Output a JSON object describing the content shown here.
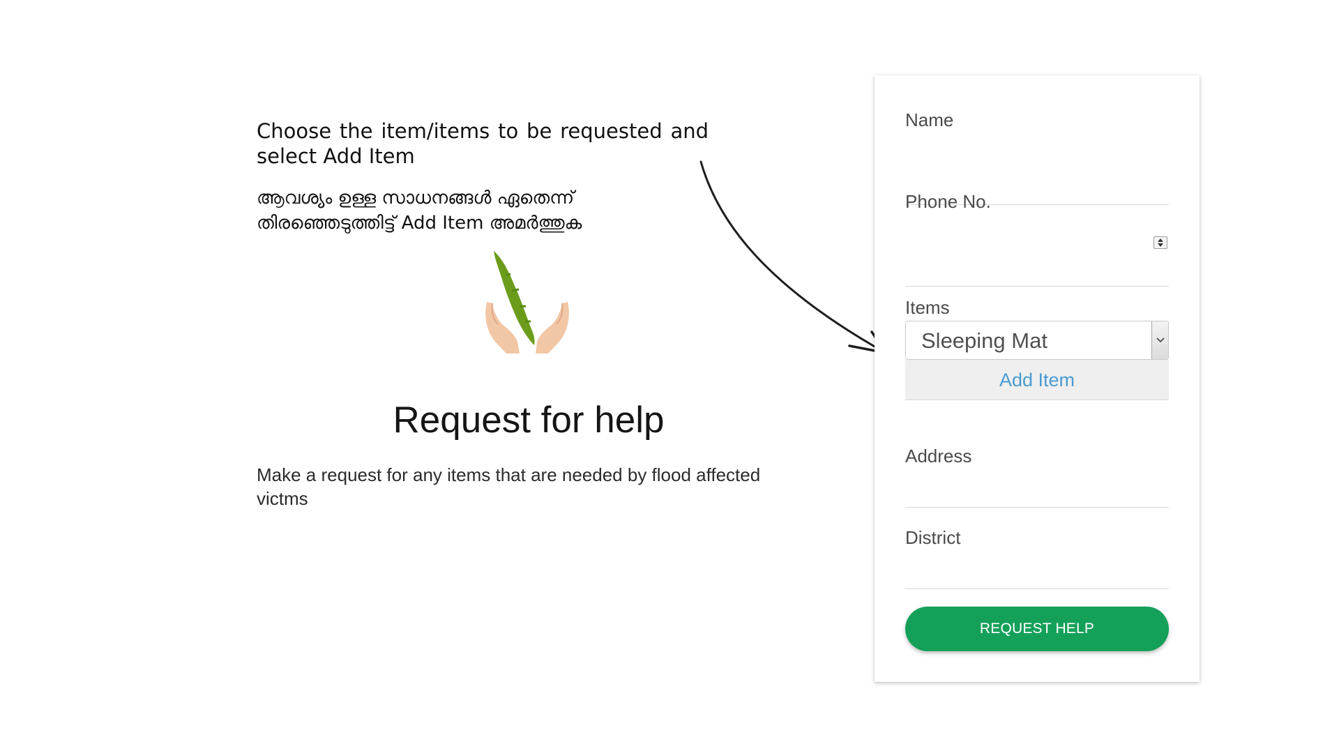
{
  "instructions": {
    "english": "Choose the item/items to be requested and select Add Item",
    "malayalam": "ആവശ്യം ഉള്ള സാധനങ്ങൾ ഏതെന്ന് തിരഞ്ഞെടുത്തിട്ട് Add Item അമർത്തുക"
  },
  "hero": {
    "title": "Request for help",
    "subtitle": "Make a request for any items that are needed by flood affected victms"
  },
  "logo": {
    "icon": "kerala-hands-logo-icon",
    "leaf_color": "#6c9c1c",
    "hand_color": "#f2c7a5"
  },
  "form": {
    "name_label": "Name",
    "phone_label": "Phone No.",
    "items_label": "Items",
    "items_selected": "Sleeping Mat",
    "add_item_label": "Add Item",
    "address_label": "Address",
    "district_label": "District",
    "submit_label": "REQUEST HELP"
  },
  "colors": {
    "button_green": "#15a05a",
    "link_blue": "#4a9bd1",
    "arrow": "#1e1e1e"
  }
}
